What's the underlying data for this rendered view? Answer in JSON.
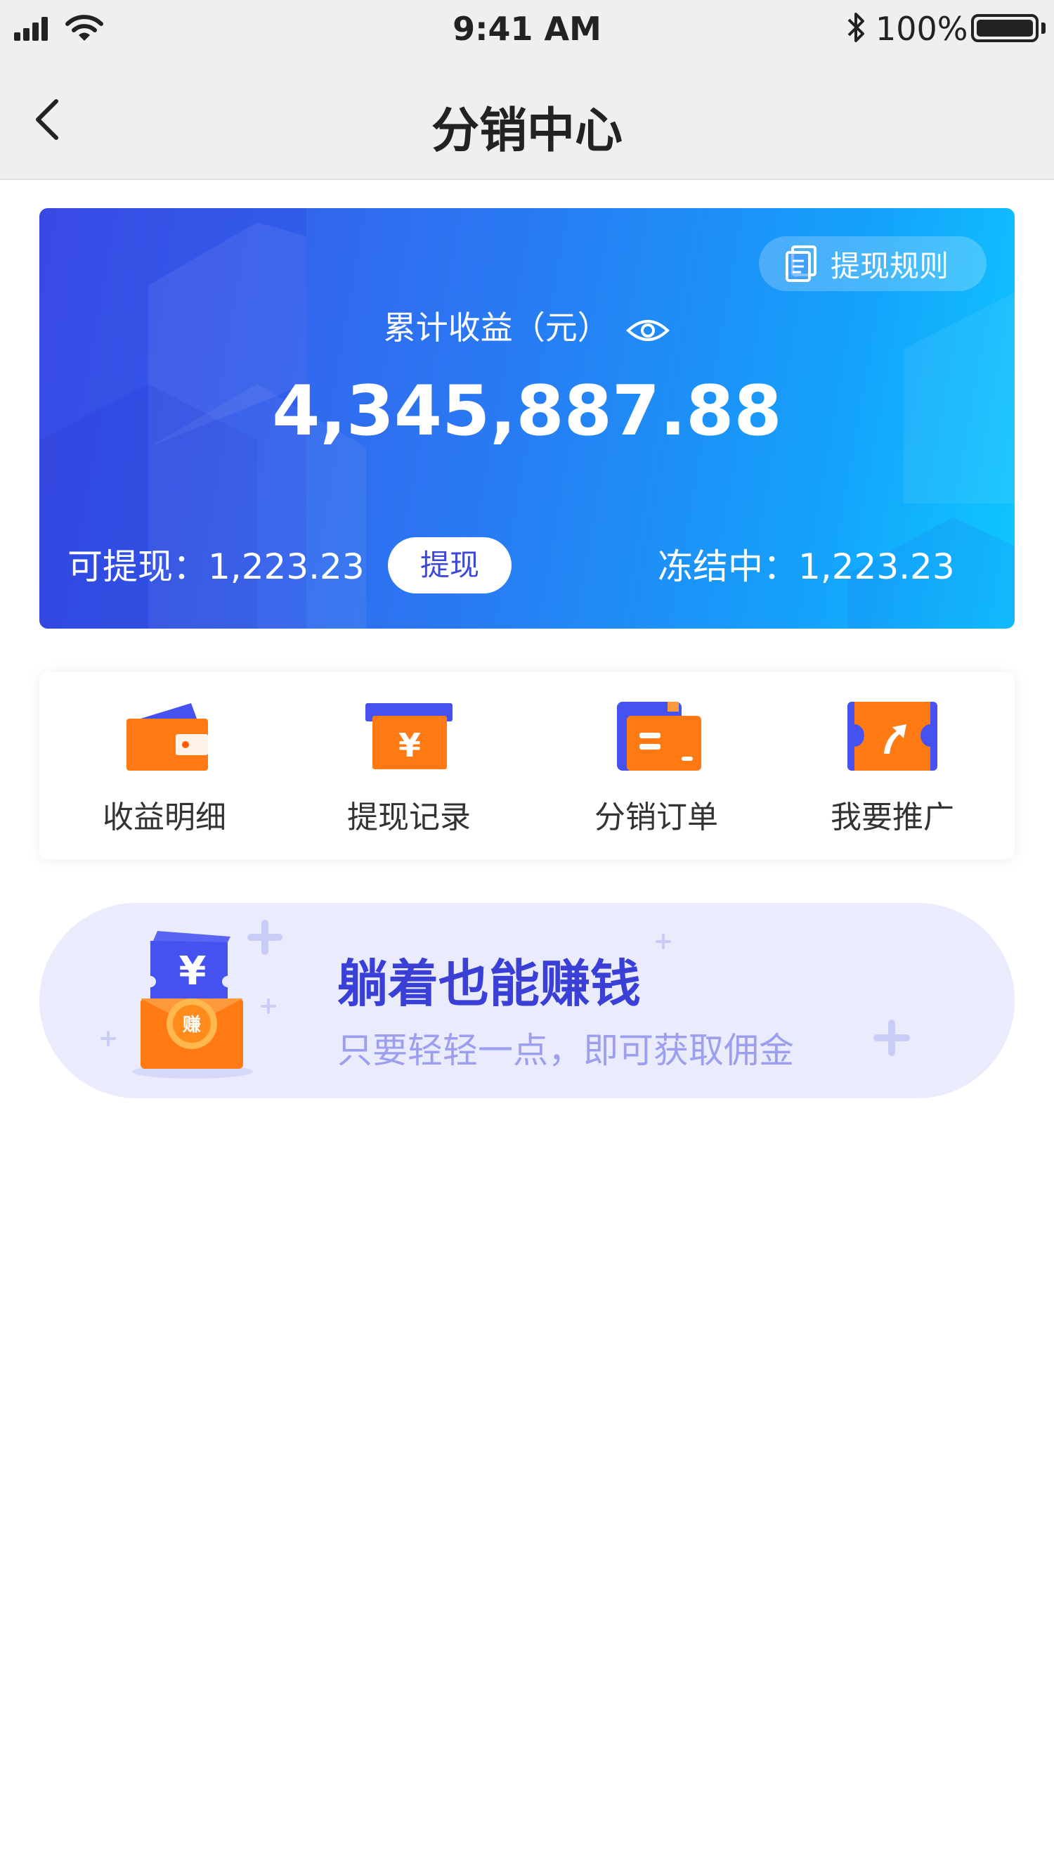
{
  "status_bar": {
    "time": "9:41 AM",
    "battery": "100%"
  },
  "nav": {
    "title": "分销中心",
    "back_icon": "chevron-left-icon"
  },
  "earnings": {
    "rules_label": "提现规则",
    "total_label": "累计收益（元）",
    "total_value": "4,345,887.88",
    "available": "可提现：1,223.23",
    "withdraw_label": "提现",
    "frozen": "冻结中：1,223.23"
  },
  "actions": [
    {
      "label": "收益明细",
      "icon": "wallet-icon"
    },
    {
      "label": "提现记录",
      "icon": "yuan-card-icon"
    },
    {
      "label": "分销订单",
      "icon": "order-folder-icon"
    },
    {
      "label": "我要推广",
      "icon": "share-ticket-icon"
    }
  ],
  "promo": {
    "title": "躺着也能赚钱",
    "subtitle": "只要轻轻一点，即可获取佣金",
    "badge_char": "赚",
    "ticket_symbol": "¥"
  },
  "colors": {
    "card_gradient": [
      "#3e4fe6",
      "#0ec8ff"
    ],
    "primary_text": "#3b48d8",
    "orange": "#ff7a12",
    "promo_bg": "#eaebfc",
    "promo_title": "#3a3fd6",
    "promo_subtitle": "#9b9fee"
  }
}
